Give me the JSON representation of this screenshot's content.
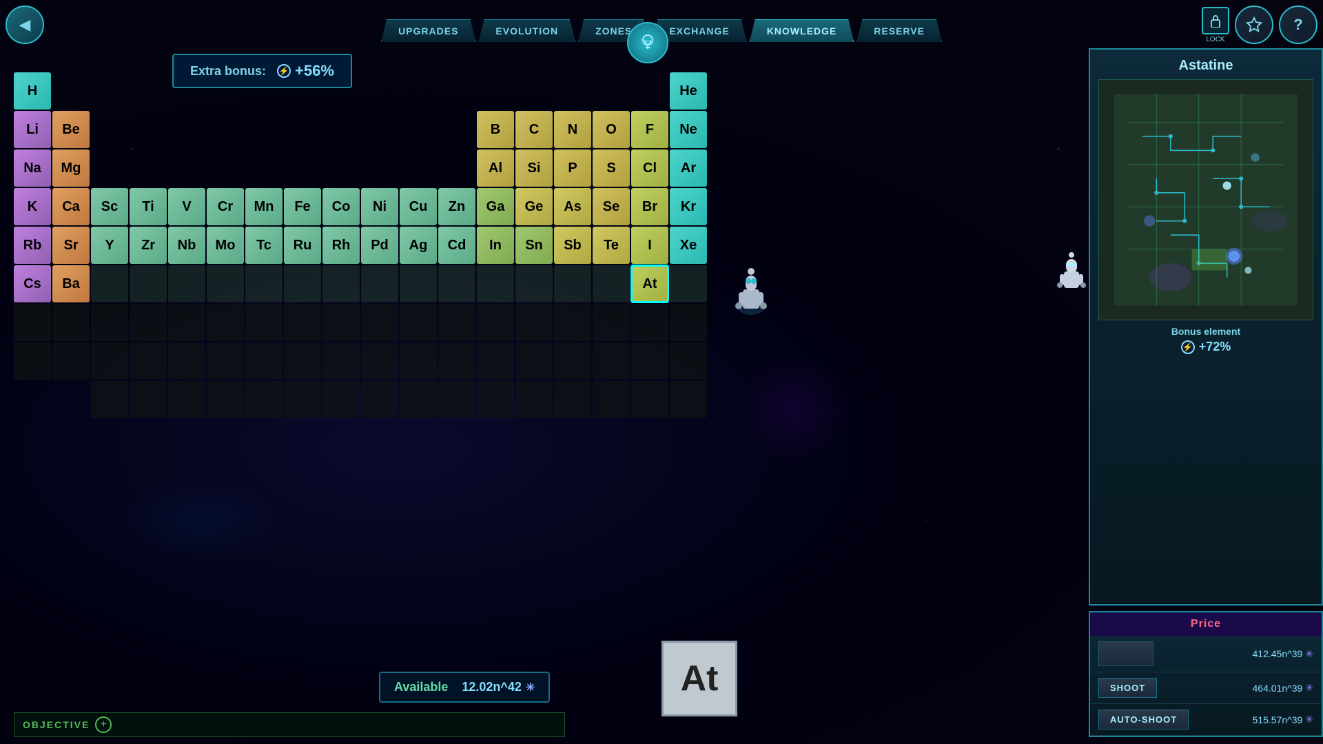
{
  "nav": {
    "tabs": [
      {
        "id": "upgrades",
        "label": "UPGRADES",
        "active": false
      },
      {
        "id": "evolution",
        "label": "EVOLUTION",
        "active": false
      },
      {
        "id": "zones",
        "label": "ZONES",
        "active": false
      },
      {
        "id": "exchange",
        "label": "EXCHANGE",
        "active": false
      },
      {
        "id": "knowledge",
        "label": "KNOWLEDGE",
        "active": true
      },
      {
        "id": "reserve",
        "label": "RESERVE",
        "active": false
      }
    ],
    "lock_label": "LOCK",
    "back_icon": "◀",
    "question_icon": "?",
    "star_icon": "★"
  },
  "extra_bonus": {
    "label": "Extra bonus:",
    "value": "+56%",
    "icon": "⚡"
  },
  "periodic_table": {
    "selected_element": "At",
    "elements": [
      {
        "symbol": "H",
        "row": 1,
        "col": 1,
        "class": "el-h"
      },
      {
        "symbol": "He",
        "row": 1,
        "col": 18,
        "class": "el-noble"
      },
      {
        "symbol": "Li",
        "row": 2,
        "col": 1,
        "class": "el-alkali"
      },
      {
        "symbol": "Be",
        "row": 2,
        "col": 2,
        "class": "el-alkaline"
      },
      {
        "symbol": "B",
        "row": 2,
        "col": 13,
        "class": "el-nonmetal"
      },
      {
        "symbol": "C",
        "row": 2,
        "col": 14,
        "class": "el-nonmetal"
      },
      {
        "symbol": "N",
        "row": 2,
        "col": 15,
        "class": "el-nonmetal"
      },
      {
        "symbol": "O",
        "row": 2,
        "col": 16,
        "class": "el-nonmetal"
      },
      {
        "symbol": "F",
        "row": 2,
        "col": 17,
        "class": "el-halogen"
      },
      {
        "symbol": "Ne",
        "row": 2,
        "col": 18,
        "class": "el-noble"
      },
      {
        "symbol": "Na",
        "row": 3,
        "col": 1,
        "class": "el-alkali"
      },
      {
        "symbol": "Mg",
        "row": 3,
        "col": 2,
        "class": "el-alkaline"
      },
      {
        "symbol": "Al",
        "row": 3,
        "col": 13,
        "class": "el-nonmetal"
      },
      {
        "symbol": "Si",
        "row": 3,
        "col": 14,
        "class": "el-nonmetal"
      },
      {
        "symbol": "P",
        "row": 3,
        "col": 15,
        "class": "el-nonmetal"
      },
      {
        "symbol": "S",
        "row": 3,
        "col": 16,
        "class": "el-nonmetal"
      },
      {
        "symbol": "Cl",
        "row": 3,
        "col": 17,
        "class": "el-halogen"
      },
      {
        "symbol": "Ar",
        "row": 3,
        "col": 18,
        "class": "el-noble"
      },
      {
        "symbol": "K",
        "row": 4,
        "col": 1,
        "class": "el-alkali"
      },
      {
        "symbol": "Ca",
        "row": 4,
        "col": 2,
        "class": "el-alkaline"
      },
      {
        "symbol": "Sc",
        "row": 4,
        "col": 3,
        "class": "el-transition"
      },
      {
        "symbol": "Ti",
        "row": 4,
        "col": 4,
        "class": "el-transition"
      },
      {
        "symbol": "V",
        "row": 4,
        "col": 5,
        "class": "el-transition"
      },
      {
        "symbol": "Cr",
        "row": 4,
        "col": 6,
        "class": "el-transition"
      },
      {
        "symbol": "Mn",
        "row": 4,
        "col": 7,
        "class": "el-transition"
      },
      {
        "symbol": "Fe",
        "row": 4,
        "col": 8,
        "class": "el-transition"
      },
      {
        "symbol": "Co",
        "row": 4,
        "col": 9,
        "class": "el-transition"
      },
      {
        "symbol": "Ni",
        "row": 4,
        "col": 10,
        "class": "el-transition"
      },
      {
        "symbol": "Cu",
        "row": 4,
        "col": 11,
        "class": "el-transition"
      },
      {
        "symbol": "Zn",
        "row": 4,
        "col": 12,
        "class": "el-transition"
      },
      {
        "symbol": "Ga",
        "row": 4,
        "col": 13,
        "class": "el-posttrans"
      },
      {
        "symbol": "Ge",
        "row": 4,
        "col": 14,
        "class": "el-metalloid"
      },
      {
        "symbol": "As",
        "row": 4,
        "col": 15,
        "class": "el-metalloid"
      },
      {
        "symbol": "Se",
        "row": 4,
        "col": 16,
        "class": "el-nonmetal"
      },
      {
        "symbol": "Br",
        "row": 4,
        "col": 17,
        "class": "el-halogen"
      },
      {
        "symbol": "Kr",
        "row": 4,
        "col": 18,
        "class": "el-noble"
      },
      {
        "symbol": "Rb",
        "row": 5,
        "col": 1,
        "class": "el-alkali"
      },
      {
        "symbol": "Sr",
        "row": 5,
        "col": 2,
        "class": "el-alkaline"
      },
      {
        "symbol": "Y",
        "row": 5,
        "col": 3,
        "class": "el-transition"
      },
      {
        "symbol": "Zr",
        "row": 5,
        "col": 4,
        "class": "el-transition"
      },
      {
        "symbol": "Nb",
        "row": 5,
        "col": 5,
        "class": "el-transition"
      },
      {
        "symbol": "Mo",
        "row": 5,
        "col": 6,
        "class": "el-transition"
      },
      {
        "symbol": "Tc",
        "row": 5,
        "col": 7,
        "class": "el-transition"
      },
      {
        "symbol": "Ru",
        "row": 5,
        "col": 8,
        "class": "el-transition"
      },
      {
        "symbol": "Rh",
        "row": 5,
        "col": 9,
        "class": "el-transition"
      },
      {
        "symbol": "Pd",
        "row": 5,
        "col": 10,
        "class": "el-transition"
      },
      {
        "symbol": "Ag",
        "row": 5,
        "col": 11,
        "class": "el-transition"
      },
      {
        "symbol": "Cd",
        "row": 5,
        "col": 12,
        "class": "el-transition"
      },
      {
        "symbol": "In",
        "row": 5,
        "col": 13,
        "class": "el-posttrans"
      },
      {
        "symbol": "Sn",
        "row": 5,
        "col": 14,
        "class": "el-posttrans"
      },
      {
        "symbol": "Sb",
        "row": 5,
        "col": 15,
        "class": "el-metalloid"
      },
      {
        "symbol": "Te",
        "row": 5,
        "col": 16,
        "class": "el-metalloid"
      },
      {
        "symbol": "I",
        "row": 5,
        "col": 17,
        "class": "el-halogen"
      },
      {
        "symbol": "Xe",
        "row": 5,
        "col": 18,
        "class": "el-noble"
      },
      {
        "symbol": "Cs",
        "row": 6,
        "col": 1,
        "class": "el-alkali"
      },
      {
        "symbol": "Ba",
        "row": 6,
        "col": 2,
        "class": "el-alkaline"
      },
      {
        "symbol": "At",
        "row": 6,
        "col": 17,
        "class": "el-halogen el-selected"
      }
    ],
    "dark_rows": [
      {
        "row": 6,
        "cols": [
          3,
          4,
          5,
          6,
          7,
          8,
          9,
          10,
          11,
          12,
          13,
          14,
          15,
          16,
          18
        ]
      },
      {
        "row": 7,
        "cols": [
          1,
          2,
          3,
          4,
          5,
          6,
          7,
          8,
          9,
          10,
          11,
          12,
          13,
          14,
          15,
          16,
          17,
          18
        ]
      },
      {
        "row": 8,
        "cols": [
          1,
          2,
          3,
          4,
          5,
          6,
          7,
          8,
          9,
          10,
          11,
          12,
          13,
          14,
          15,
          16,
          17,
          18
        ]
      },
      {
        "row": 9,
        "cols": [
          3,
          4,
          5,
          6,
          7,
          8,
          9,
          10,
          11,
          12,
          13,
          14,
          15,
          16,
          17,
          18
        ]
      }
    ]
  },
  "right_panel": {
    "element_name": "Astatine",
    "bonus_element_label": "Bonus element",
    "bonus_value": "+72%",
    "bonus_icon": "⚡"
  },
  "price_panel": {
    "header": "Price",
    "base_price": "412.45n^39",
    "shoot_label": "SHOOT",
    "shoot_price": "464.01n^39",
    "auto_shoot_label": "AUTO-SHOOT",
    "auto_shoot_price": "515.57n^39",
    "crystal_icon": "✳"
  },
  "available": {
    "label": "Available",
    "value": "12.02n^42",
    "icon": "✳"
  },
  "objective": {
    "label": "OBJECTIVE",
    "plus_icon": "+"
  },
  "at_element": {
    "symbol": "At"
  }
}
